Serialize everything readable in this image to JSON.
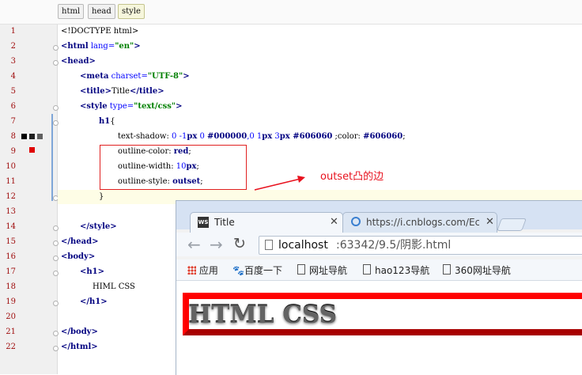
{
  "breadcrumbs": [
    "html",
    "head",
    "style"
  ],
  "line_numbers": [
    "1",
    "2",
    "3",
    "4",
    "5",
    "6",
    "7",
    "8",
    "9",
    "10",
    "11",
    "12",
    "13",
    "14",
    "15",
    "16",
    "17",
    "18",
    "19",
    "20",
    "21",
    "22"
  ],
  "code": {
    "l1": "<!DOCTYPE html>",
    "l2_tag": "<html",
    "l2_attr": " lang=",
    "l2_val": "\"en\"",
    "l2_end": ">",
    "l3": "<head>",
    "l4_tag": "<meta",
    "l4_attr": " charset=",
    "l4_val": "\"UTF-8\"",
    "l4_end": ">",
    "l5_open": "<title>",
    "l5_text": "Title",
    "l5_close": "</title>",
    "l6_tag": "<style",
    "l6_attr": " type=",
    "l6_val": "\"text/css\"",
    "l6_end": ">",
    "l7_sel": "h1",
    "l7_brace": "{",
    "l8_prop": "text-shadow: ",
    "l8_v1": "0 -1",
    "l8_u1": "px",
    "l8_v2": " 0 ",
    "l8_c1": "#000000",
    "l8_v3": ",0 1",
    "l8_u2": "px",
    "l8_v4": " 3",
    "l8_u3": "px",
    "l8_c2": " #606060",
    "l8_v5": " ;color: ",
    "l8_c3": "#606060",
    "l8_end": ";",
    "l9_prop": "outline-color: ",
    "l9_val": "red",
    "l9_end": ";",
    "l10_prop": "outline-width: ",
    "l10_num": "10",
    "l10_unit": "px",
    "l10_end": ";",
    "l11_prop": "outline-style: ",
    "l11_val": "outset",
    "l11_end": ";",
    "l12": "}",
    "l14": "</style>",
    "l15": "</head>",
    "l16": "<body>",
    "l17": "<h1>",
    "l18": "HIML CSS",
    "l19": "</h1>",
    "l21": "</body>",
    "l22": "</html>"
  },
  "annotation": "outset凸的边",
  "browser": {
    "tabs": [
      {
        "title": "Title",
        "favicon": "ws-icon"
      },
      {
        "title": "https://i.cnblogs.com/Ec",
        "favicon": "globe-icon"
      }
    ],
    "address_host": "localhost",
    "address_rest": ":63342/9.5/阴影.html",
    "bookmarks": [
      "应用",
      "百度一下",
      "网址导航",
      "hao123导航",
      "360网址导航"
    ],
    "heading": "HTML CSS"
  },
  "colors": {
    "outline_red": "#ff0000",
    "annotation_red": "#e8121e",
    "heading_gray": "#606060"
  }
}
